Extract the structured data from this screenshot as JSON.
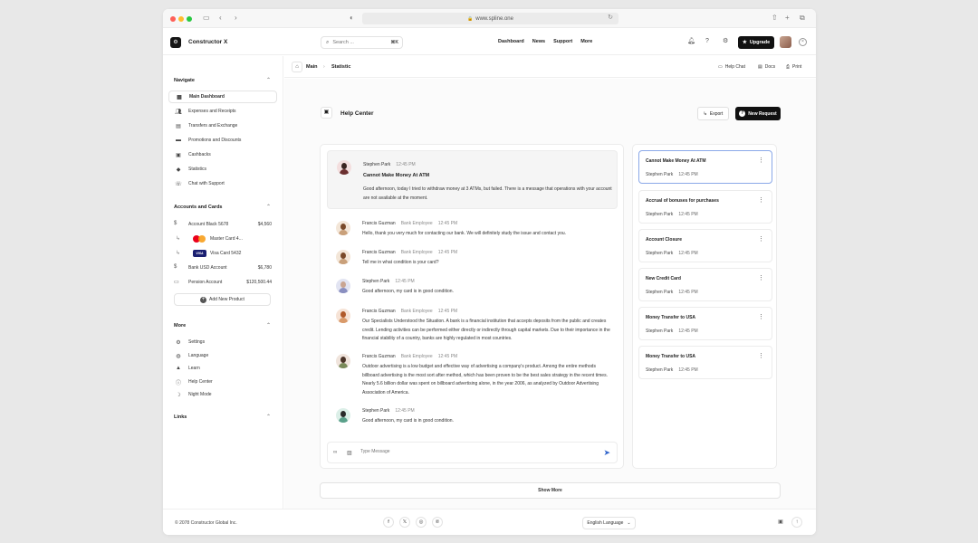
{
  "browser": {
    "url": "www.spline.one"
  },
  "header": {
    "brand": "Constructor X",
    "logo_glyph": "⚙",
    "search_placeholder": "Search ...",
    "search_shortcut": "⌘K",
    "nav": [
      "Dashboard",
      "News",
      "Support",
      "More"
    ],
    "upgrade_label": "Upgrade"
  },
  "sidebar": {
    "navigate_title": "Navigate",
    "navigate_items": [
      {
        "label": "Main Dashboard",
        "icon": "grid-icon"
      },
      {
        "label": "Expenses and Receipts",
        "icon": "users-icon"
      },
      {
        "label": "Transfers and Exchange",
        "icon": "document-icon"
      },
      {
        "label": "Promotions and Discounts",
        "icon": "folder-icon"
      },
      {
        "label": "Cashbacks",
        "icon": "chat-icon"
      },
      {
        "label": "Statistics",
        "icon": "tag-icon"
      },
      {
        "label": "Chat with Support",
        "icon": "support-icon"
      }
    ],
    "accounts_title": "Accounts and Cards",
    "accounts": [
      {
        "label": "Account Black 5678",
        "amount": "$4,560"
      },
      {
        "label": "Master Card 4...",
        "amount": ""
      },
      {
        "label": "Visa Card 5432",
        "amount": ""
      },
      {
        "label": "Bank USD Account",
        "amount": "$6,780"
      },
      {
        "label": "Pension Account",
        "amount": "$120,500.44"
      }
    ],
    "visa_text": "VISA",
    "add_product_label": "Add New Product",
    "more_title": "More",
    "more_items": [
      {
        "label": "Settings",
        "icon": "gear-icon"
      },
      {
        "label": "Language",
        "icon": "globe-icon"
      },
      {
        "label": "Learn",
        "icon": "graduation-icon"
      },
      {
        "label": "Help Center",
        "icon": "help-icon"
      },
      {
        "label": "Night Mode",
        "icon": "moon-icon"
      }
    ],
    "links_title": "Links"
  },
  "breadcrumb": {
    "items": [
      "Main",
      "Statistic"
    ]
  },
  "toolbar": {
    "help_chat": "Help Chat",
    "docs": "Docs",
    "print": "Print"
  },
  "help_center": {
    "title": "Help Center",
    "export_label": "Export",
    "new_request_label": "New Request"
  },
  "chat": {
    "messages": [
      {
        "name": "Stephen Park",
        "role": "",
        "time": "12:45 PM",
        "subject": "Cannot Make Money At ATM",
        "text": "Good afternoon, today I tried to withdraw money at 3 ATMs, but failed. There is a message that operations with your account are not available at the moment."
      },
      {
        "name": "Francis Guzman",
        "role": "Bank Employee",
        "time": "12:45 PM",
        "text": "Hello, thank you very much for contacting our bank. We will definitely study the issue and contact you."
      },
      {
        "name": "Francis Guzman",
        "role": "Bank Employee",
        "time": "12:45 PM",
        "text": "Tell me in what condition is your card?"
      },
      {
        "name": "Stephen Park",
        "role": "",
        "time": "12:45 PM",
        "text": "Good afternoon, my card is in good condition."
      },
      {
        "name": "Francis Guzman",
        "role": "Bank Employee",
        "time": "12:45 PM",
        "text": "Our Specialists Understood the Situation. A bank is a financial institution that accepts deposits from the public and creates credit. Lending activities can be performed either directly or indirectly through capital markets. Due to their importance in the financial stability of a country, banks are highly regulated in most countries."
      },
      {
        "name": "Francis Guzman",
        "role": "Bank Employee",
        "time": "12:45 PM",
        "text": "Outdoor advertising is a low budget and effective way of advertising a company's product. Among the entire methods billboard advertising is the most sort after method, which has been proven to be the best sales strategy in the recent times. Nearly 5.6 billion dollar was spent on billboard advertising alone, in the year 2006, as analyzed by Outdoor Advertising Association of America."
      },
      {
        "name": "Stephen Park",
        "role": "",
        "time": "12:45 PM",
        "text": "Good afternoon, my card is in good condition."
      }
    ],
    "input_placeholder": "Type Message"
  },
  "tickets": [
    {
      "title": "Cannot Make Money At ATM",
      "name": "Stephen Park",
      "time": "12:45 PM"
    },
    {
      "title": "Accrual of bonuses for purchases",
      "name": "Stephen Park",
      "time": "12:45 PM"
    },
    {
      "title": "Account Closure",
      "name": "Stephen Park",
      "time": "12:45 PM"
    },
    {
      "title": "New Credit Card",
      "name": "Stephen Park",
      "time": "12:45 PM"
    },
    {
      "title": "Money Transfer to USA",
      "name": "Stephen Park",
      "time": "12:45 PM"
    },
    {
      "title": "Money Transfer to USA",
      "name": "Stephen Park",
      "time": "12:45 PM"
    }
  ],
  "show_more_label": "Show More",
  "footer": {
    "copyright": "© 2078 Constructor Global Inc.",
    "social": [
      {
        "icon": "facebook-icon",
        "glyph": "f"
      },
      {
        "icon": "x-icon",
        "glyph": "𝕏"
      },
      {
        "icon": "instagram-icon",
        "glyph": "◎"
      },
      {
        "icon": "pinterest-icon",
        "glyph": "℗"
      }
    ],
    "language": "English Language"
  },
  "colors": {
    "accent": "#111111",
    "active_ticket_border": "#8aa8e8",
    "send": "#3366cc"
  }
}
